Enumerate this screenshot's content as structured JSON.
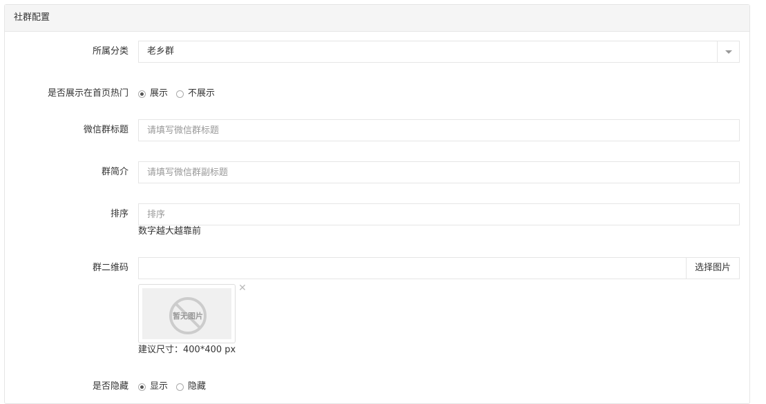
{
  "panel": {
    "title": "社群配置"
  },
  "category": {
    "label": "所属分类",
    "selected": "老乡群"
  },
  "show_hot": {
    "label": "是否展示在首页热门",
    "options": [
      "展示",
      "不展示"
    ],
    "selected_index": 0
  },
  "wechat_title": {
    "label": "微信群标题",
    "placeholder": "请填写微信群标题",
    "value": ""
  },
  "group_intro": {
    "label": "群简介",
    "placeholder": "请填写微信群副标题",
    "value": ""
  },
  "sort": {
    "label": "排序",
    "placeholder": "排序",
    "value": "",
    "help": "数字越大越靠前"
  },
  "qrcode": {
    "label": "群二维码",
    "value": "",
    "choose_button": "选择图片",
    "no_image_text": "暂无图片",
    "size_hint": "建议尺寸：400*400 px"
  },
  "hidden": {
    "label": "是否隐藏",
    "options": [
      "显示",
      "隐藏"
    ],
    "selected_index": 0
  },
  "icons": {
    "dropdown": "chevron-down-icon",
    "remove": "close-icon",
    "no_image": "prohibited-icon"
  }
}
